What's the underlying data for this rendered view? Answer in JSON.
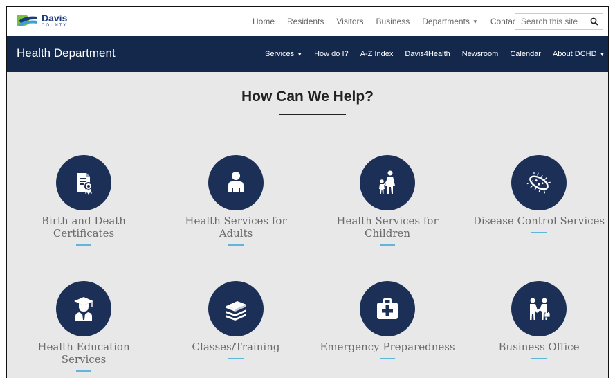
{
  "brand": {
    "name": "Davis",
    "sub": "COUNTY"
  },
  "topnav": {
    "items": [
      "Home",
      "Residents",
      "Visitors",
      "Business",
      "Departments",
      "Contact"
    ],
    "search_placeholder": "Search this site"
  },
  "deptnav": {
    "title": "Health Department",
    "items": [
      "Services",
      "How do I?",
      "A-Z Index",
      "Davis4Health",
      "Newsroom",
      "Calendar",
      "About DCHD"
    ]
  },
  "main": {
    "heading": "How Can We Help?",
    "tiles": [
      {
        "label": "Birth and Death Certificates",
        "icon": "certificate-icon"
      },
      {
        "label": "Health Services for Adults",
        "icon": "adult-person-icon"
      },
      {
        "label": "Health Services for Children",
        "icon": "parent-child-icon"
      },
      {
        "label": "Disease Control Services",
        "icon": "bacteria-icon"
      },
      {
        "label": "Health Education Services",
        "icon": "graduate-icon"
      },
      {
        "label": "Classes/Training",
        "icon": "books-icon"
      },
      {
        "label": "Emergency Preparedness",
        "icon": "first-aid-kit-icon"
      },
      {
        "label": "Business Office",
        "icon": "business-handshake-icon"
      }
    ]
  },
  "colors": {
    "dept_bar": "#14284b",
    "icon_circle": "#1c2f57",
    "accent_bar": "#5fb6d9",
    "page_bg": "#e8e8e8"
  }
}
